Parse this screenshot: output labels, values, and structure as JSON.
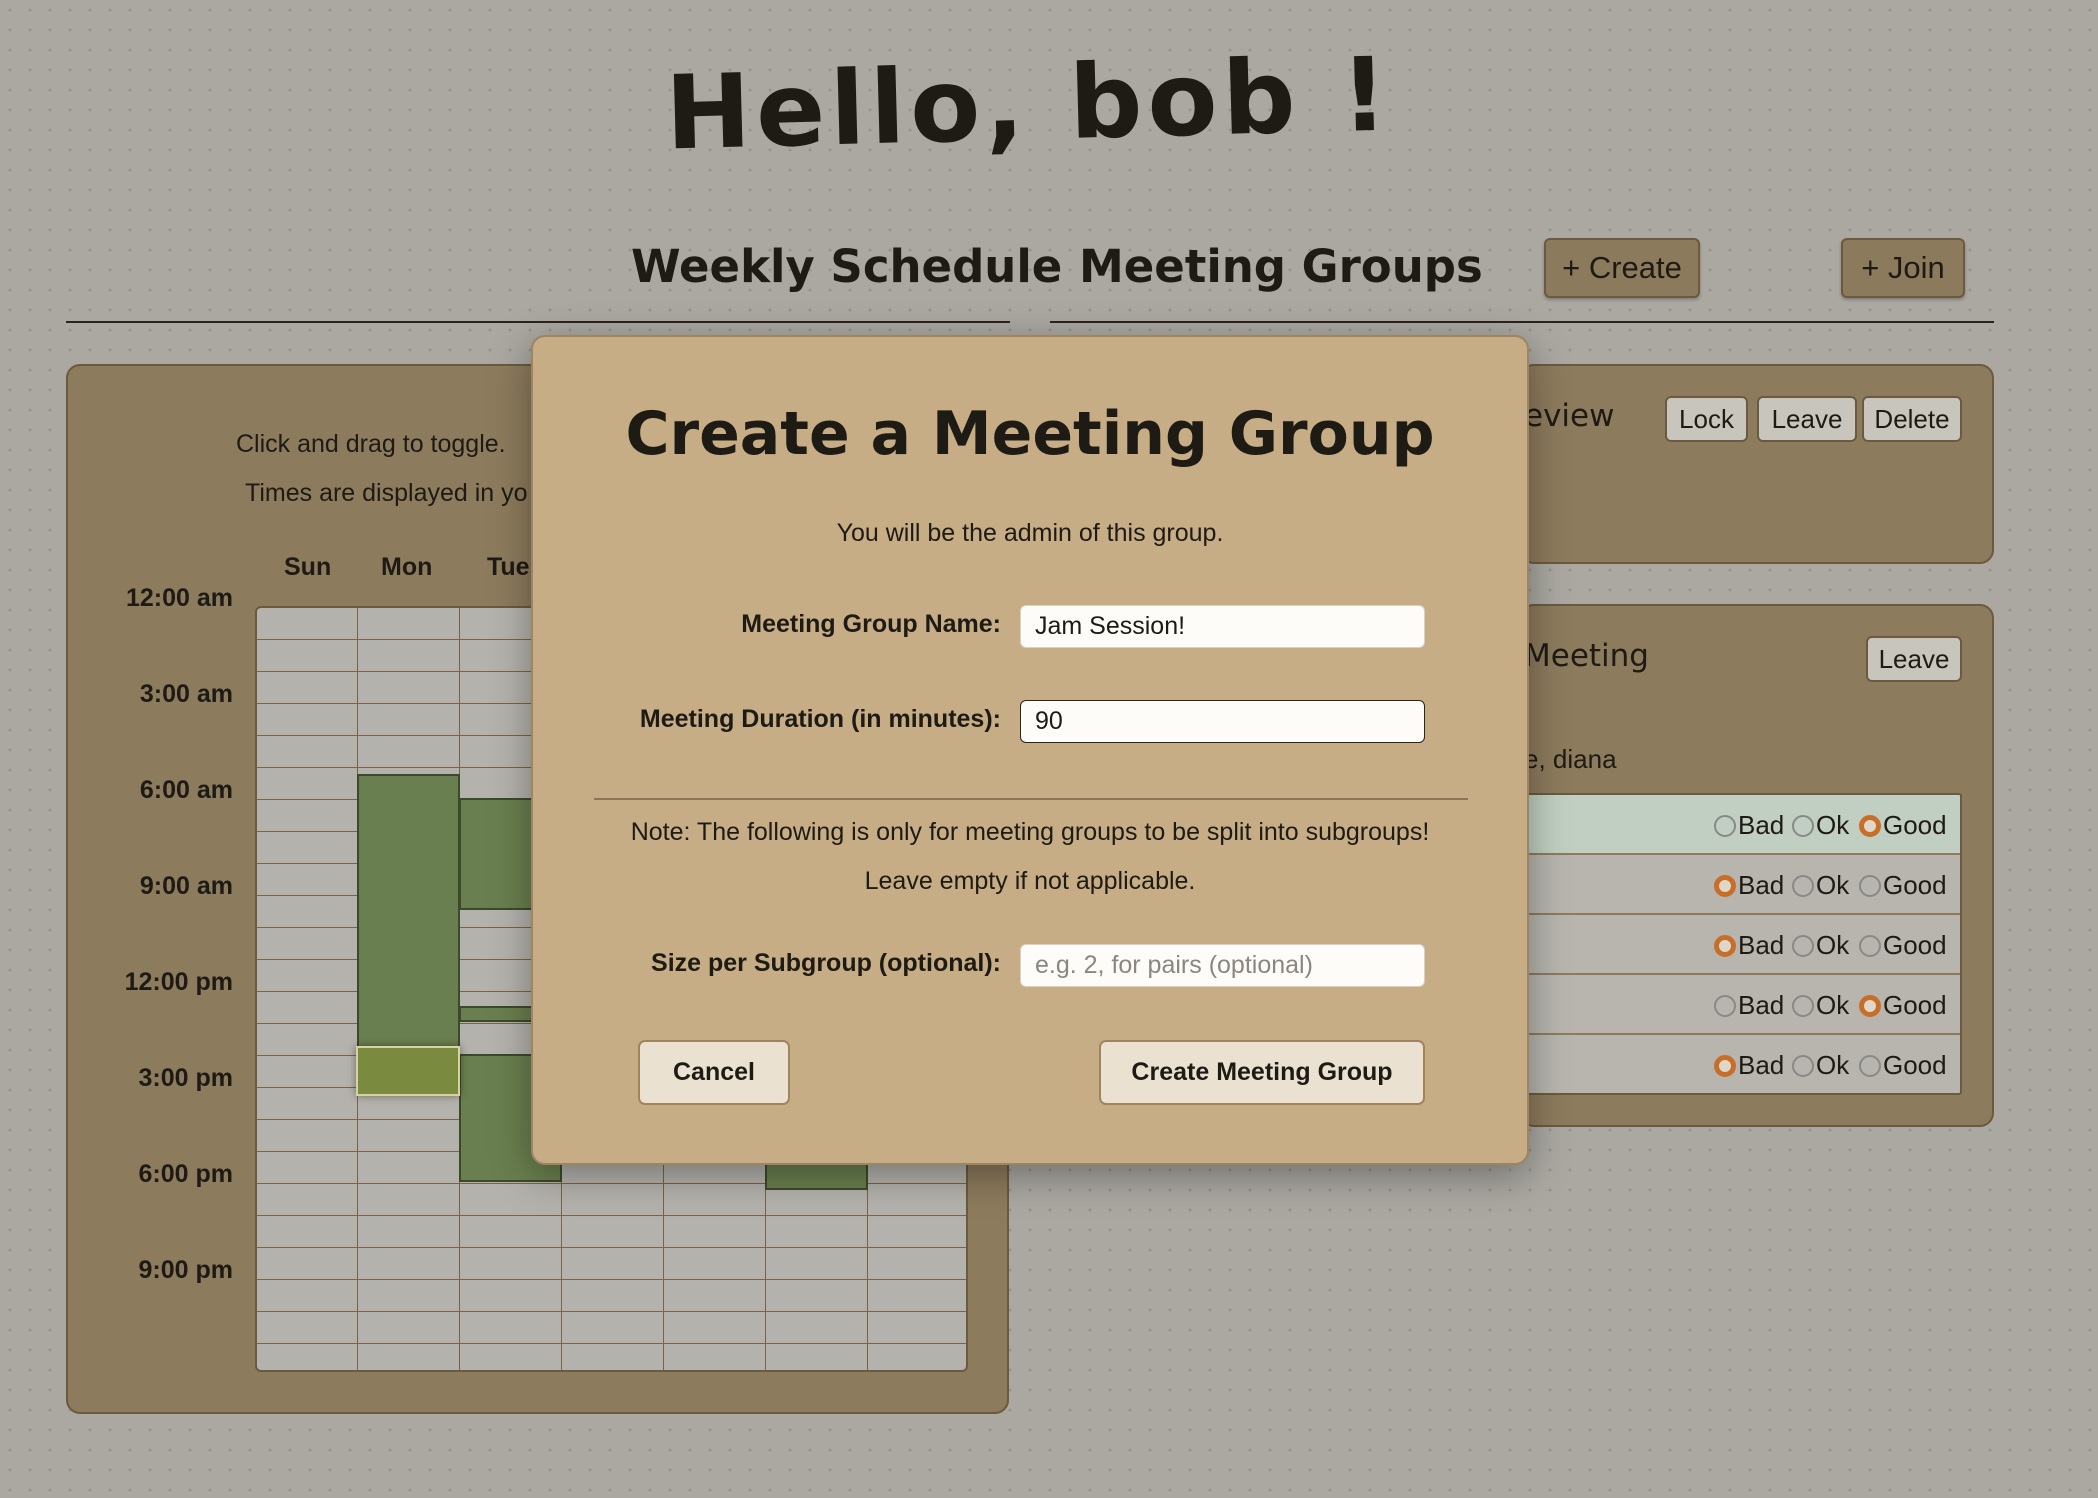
{
  "greeting": "Hello, bob !",
  "nav": {
    "weekly_schedule": "Weekly Schedule",
    "meeting_groups": "Meeting Groups",
    "create_label": "+ Create",
    "join_label": "+ Join"
  },
  "schedule": {
    "hint_toggle": "Click and drag to toggle.",
    "hint_timezone": "Times are displayed in yo",
    "days": [
      "Sun",
      "Mon",
      "Tue"
    ],
    "times": [
      "12:00 am",
      "3:00 am",
      "6:00 am",
      "9:00 am",
      "12:00 pm",
      "3:00 pm",
      "6:00 pm",
      "9:00 pm"
    ]
  },
  "group1": {
    "title_fragment": "eview",
    "lock_label": "Lock",
    "leave_label": "Leave",
    "delete_label": "Delete"
  },
  "group2": {
    "title_fragment": "Meeting",
    "leave_label": "Leave",
    "members_fragment": "e, diana",
    "option_labels": [
      "Bad",
      "Ok",
      "Good"
    ],
    "votes": [
      "Good",
      "Bad",
      "Bad",
      "Good",
      "Bad"
    ]
  },
  "modal": {
    "title": "Create a Meeting Group",
    "subtitle": "You will be the admin of this group.",
    "name_label": "Meeting Group Name:",
    "name_value": "Jam Session!",
    "duration_label": "Meeting Duration (in minutes):",
    "duration_value": "90",
    "note_line1": "Note: The following is only for meeting groups to be split into subgroups!",
    "note_line2": "Leave empty if not applicable.",
    "subgroup_label": "Size per Subgroup (optional):",
    "subgroup_placeholder": "e.g. 2, for pairs (optional)",
    "cancel_label": "Cancel",
    "create_label": "Create Meeting Group"
  },
  "colors": {
    "panel": "#8d7b5d",
    "modal": "#c6ad86",
    "available": "#6a7f4f",
    "radio_selected": "#c76f2a"
  }
}
